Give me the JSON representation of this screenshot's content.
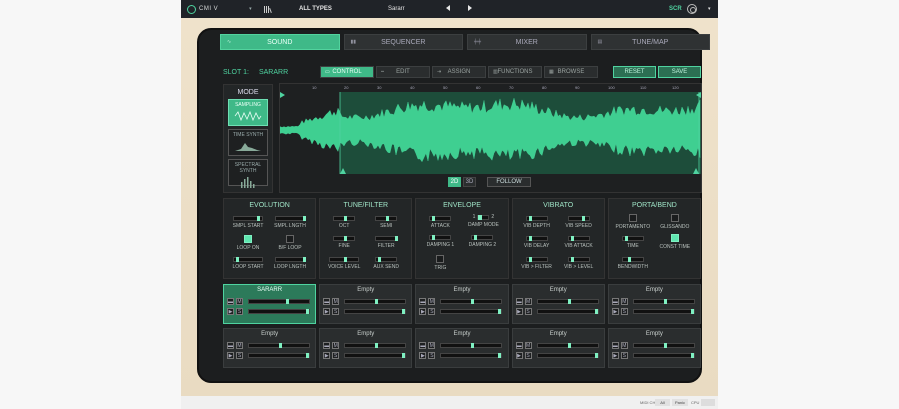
{
  "topbar": {
    "app_name": "CMI V",
    "preset_type": "ALL TYPES",
    "preset_name": "Sararr",
    "scr_label": "SCR"
  },
  "main_tabs": [
    {
      "label": "SOUND",
      "active": true
    },
    {
      "label": "SEQUENCER",
      "active": false
    },
    {
      "label": "MIXER",
      "active": false
    },
    {
      "label": "TUNE/MAP",
      "active": false
    }
  ],
  "slot_header": {
    "slot_label": "SLOT 1:",
    "slot_name": "SARARR"
  },
  "subtabs": [
    {
      "label": "CONTROL",
      "active": true
    },
    {
      "label": "EDIT",
      "active": false
    },
    {
      "label": "ASSIGN",
      "active": false
    },
    {
      "label": "FUNCTIONS",
      "active": false
    },
    {
      "label": "BROWSE",
      "active": false
    }
  ],
  "actions": {
    "reset": "RESET",
    "save": "SAVE"
  },
  "mode": {
    "title": "MODE",
    "options": [
      {
        "label": "SAMPLING",
        "active": true
      },
      {
        "label": "TIME SYNTH",
        "active": false
      },
      {
        "label": "SPECTRAL SYNTH",
        "active": false
      }
    ]
  },
  "waveform": {
    "ruler": [
      "10",
      "20",
      "30",
      "40",
      "50",
      "60",
      "70",
      "80",
      "90",
      "100",
      "110",
      "120"
    ],
    "view_2d": "2D",
    "view_3d": "3D",
    "follow": "FOLLOW"
  },
  "sections": {
    "evolution": {
      "title": "EVOLUTION",
      "smpl_start": "SMPL START",
      "smpl_length": "SMPL LNGTH",
      "loop_on": "LOOP ON",
      "bf_loop": "B/F LOOP",
      "loop_start": "LOOP START",
      "loop_length": "LOOP LNGTH"
    },
    "tune_filter": {
      "title": "TUNE/FILTER",
      "oct": "OCT",
      "semi": "SEMI",
      "fine": "FINE",
      "filter": "FILTER",
      "voice_level": "VOICE LEVEL",
      "aux_send": "AUX SEND"
    },
    "envelope": {
      "title": "ENVELOPE",
      "attack": "ATTACK",
      "damp_mode": "DAMP MODE",
      "damp_mode_1": "1",
      "damp_mode_2": "2",
      "damping1": "DAMPING 1",
      "damping2": "DAMPING 2",
      "trig": "TRIG"
    },
    "vibrato": {
      "title": "VIBRATO",
      "depth": "VIB DEPTH",
      "speed": "VIB SPEED",
      "delay": "VIB DELAY",
      "attack": "VIB ATTACK",
      "to_filter": "VIB > FILTER",
      "to_level": "VIB > LEVEL"
    },
    "porta_bend": {
      "title": "PORTA/BEND",
      "portamento": "PORTAMENTO",
      "glissando": "GLISSANDO",
      "time": "TIME",
      "const_time": "CONST TIME",
      "bendwidth": "BENDWIDTH"
    }
  },
  "slots": [
    {
      "name": "SARARR",
      "active": true
    },
    {
      "name": "Empty",
      "active": false
    },
    {
      "name": "Empty",
      "active": false
    },
    {
      "name": "Empty",
      "active": false
    },
    {
      "name": "Empty",
      "active": false
    },
    {
      "name": "Empty",
      "active": false
    },
    {
      "name": "Empty",
      "active": false
    },
    {
      "name": "Empty",
      "active": false
    },
    {
      "name": "Empty",
      "active": false
    },
    {
      "name": "Empty",
      "active": false
    }
  ],
  "slot_buttons": {
    "mute": "M",
    "solo": "S"
  },
  "status": {
    "midi_ch": "MIDI CH",
    "all": "All",
    "panic": "Panic",
    "cpu": "CPU"
  },
  "colors": {
    "accent": "#3fb988",
    "highlight": "#7ff0c2",
    "bezel": "#ecdfc6",
    "panel": "#232627"
  }
}
